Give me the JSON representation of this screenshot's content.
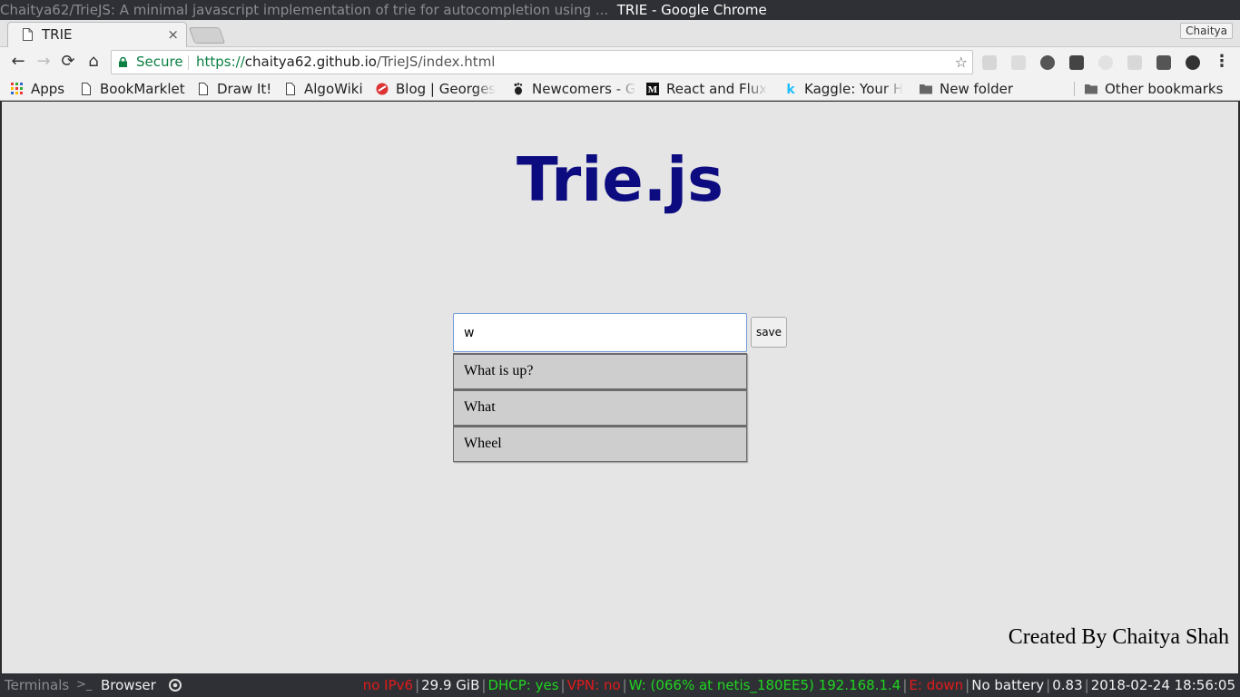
{
  "window": {
    "title_dim": "Chaitya62/TrieJS: A minimal javascript implementation of trie for autocompletion using ...",
    "title_main": "TRIE - Google Chrome"
  },
  "tabs": [
    {
      "label": "TRIE",
      "close": "×"
    }
  ],
  "profile": {
    "name": "Chaitya"
  },
  "toolbar": {
    "back": "←",
    "forward": "→",
    "reload": "⟳",
    "home": "⌂",
    "menu": "⋮"
  },
  "omnibox": {
    "secure_label": "Secure",
    "url_scheme": "https://",
    "url_host": "chaitya62.github.io",
    "url_path": "/TrieJS/index.html",
    "star": "☆"
  },
  "bookmarks": {
    "items": [
      {
        "label": "Apps",
        "icon": "apps-grid-icon"
      },
      {
        "label": "BookMarklet",
        "icon": "page-icon"
      },
      {
        "label": "Draw It!",
        "icon": "page-icon"
      },
      {
        "label": "AlgoWiki",
        "icon": "page-icon"
      },
      {
        "label": "Blog | Georges",
        "icon": "red-site-icon"
      },
      {
        "label": "Newcomers - G",
        "icon": "gnome-icon"
      },
      {
        "label": "React and Flux",
        "icon": "medium-icon"
      },
      {
        "label": "Kaggle: Your H",
        "icon": "kaggle-icon"
      },
      {
        "label": "New folder",
        "icon": "folder-icon"
      }
    ],
    "other": "Other bookmarks"
  },
  "page": {
    "title": "Trie.js",
    "search": {
      "value": "w"
    },
    "save_label": "save",
    "suggestions": [
      "What is up?",
      "What",
      "Wheel"
    ],
    "credit": "Created By Chaitya Shah"
  },
  "statusbar": {
    "workspaces": [
      "Terminals",
      ">_",
      "Browser"
    ],
    "segments": [
      {
        "text": "no IPv6",
        "color": "red"
      },
      {
        "text": "29.9 GiB",
        "color": "white"
      },
      {
        "text": "DHCP: yes",
        "color": "green"
      },
      {
        "text": "VPN: no",
        "color": "red"
      },
      {
        "text": "W: (066% at netis_180EE5) 192.168.1.4",
        "color": "green"
      },
      {
        "text": "E: down",
        "color": "red"
      },
      {
        "text": "No battery",
        "color": "white"
      },
      {
        "text": "0.83",
        "color": "white"
      },
      {
        "text": "2018-02-24 18:56:05",
        "color": "white"
      }
    ]
  },
  "colors": {
    "title_blue": "#0c0c80",
    "page_bg": "#e5e5e5",
    "suggestion_bg": "#cecece",
    "secure_green": "#0b8043"
  }
}
